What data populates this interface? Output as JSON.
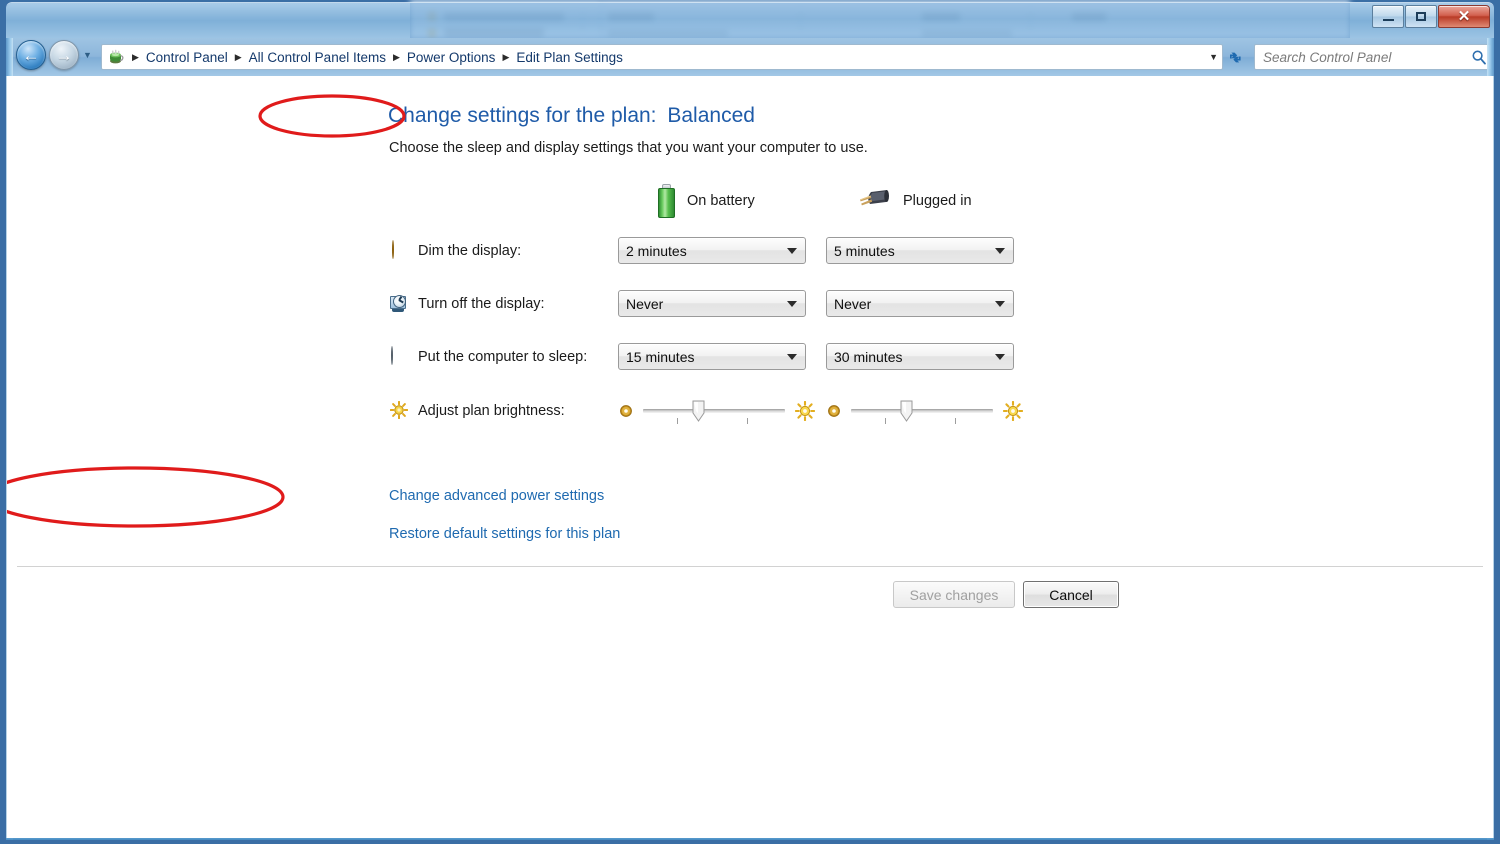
{
  "window": {
    "controls": {
      "minimize_label": "Minimize",
      "maximize_label": "Maximize",
      "close_label": "Close"
    }
  },
  "navbar": {
    "back_label": "Back",
    "forward_label": "Forward",
    "recent_pages_label": "Recent pages",
    "refresh_label": "Refresh",
    "breadcrumb": [
      "Control Panel",
      "All Control Panel Items",
      "Power Options",
      "Edit Plan Settings"
    ],
    "breadcrumb_separator": "▶",
    "address_dropdown_label": "▼",
    "control_panel_icon": "control-panel-icon"
  },
  "search": {
    "placeholder": "Search Control Panel",
    "value": "",
    "icon": "search-icon"
  },
  "main": {
    "title_prefix": "Change settings for the plan:",
    "title_plan": "Balanced",
    "subtitle": "Choose the sleep and display settings that you want your computer to use.",
    "columns": [
      {
        "label": "On battery",
        "icon": "battery-icon"
      },
      {
        "label": "Plugged in",
        "icon": "power-plug-icon"
      }
    ],
    "rows": [
      {
        "icon": "dim-display-icon",
        "label": "Dim the display:",
        "on_battery": "2 minutes",
        "plugged_in": "5 minutes"
      },
      {
        "icon": "turn-off-display-icon",
        "label": "Turn off the display:",
        "on_battery": "Never",
        "plugged_in": "Never"
      },
      {
        "icon": "sleep-icon",
        "label": "Put the computer to sleep:",
        "on_battery": "15 minutes",
        "plugged_in": "30 minutes"
      }
    ],
    "brightness": {
      "icon": "brightness-icon",
      "label": "Adjust plan brightness:",
      "low_icon": "dim-sun-icon",
      "high_icon": "bright-sun-icon",
      "on_battery_percent": 38,
      "plugged_in_percent": 38
    },
    "links": [
      {
        "label": "Change advanced power settings",
        "annotated": true
      },
      {
        "label": "Restore default settings for this plan",
        "annotated": false
      }
    ],
    "buttons": {
      "save": "Save changes",
      "save_enabled": false,
      "cancel": "Cancel",
      "cancel_enabled": true
    }
  },
  "annotations": {
    "color": "#e01b1b",
    "items": [
      {
        "target": "plan-name",
        "shape": "ellipse"
      },
      {
        "target": "change-advanced-power-settings-link",
        "shape": "ellipse"
      }
    ]
  }
}
